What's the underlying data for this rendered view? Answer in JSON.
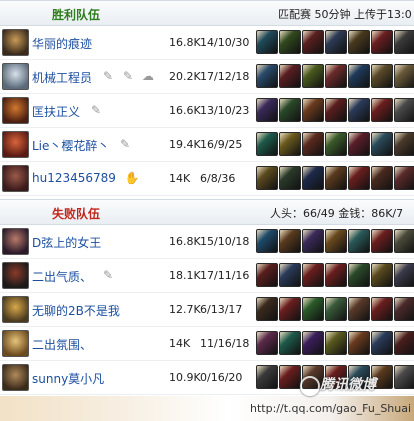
{
  "win_team": {
    "title": "胜利队伍",
    "info": "匹配赛 50分钟 上传于13:0",
    "players": [
      {
        "name": "华丽的痕迹",
        "gold": "16.8K",
        "kda": "14/10/30",
        "badges": [],
        "avatar": [
          "#3a2a1c",
          "#c89b57"
        ],
        "items": [
          "#1f4a5a",
          "#314a1e",
          "#5a1f1f",
          "#2c3a55",
          "#4a3a1e",
          "#6a1e20",
          "#3a3a3a"
        ]
      },
      {
        "name": "机械工程员",
        "gold": "20.2K",
        "kda": "17/12/18",
        "badges": [
          "✎",
          "✎",
          "☁"
        ],
        "avatar": [
          "#5a6a7a",
          "#d8e0ea"
        ],
        "items": [
          "#2a4a6a",
          "#5a1e22",
          "#4a5a1e",
          "#6a2a2a",
          "#1e3a5a",
          "#5a4a2a",
          "#6a5a3a"
        ]
      },
      {
        "name": "匡扶正义",
        "gold": "16.6K",
        "kda": "13/10/23",
        "badges": [
          "✎"
        ],
        "avatar": [
          "#4a1e10",
          "#d2782e"
        ],
        "items": [
          "#3a2a5a",
          "#2a4a2a",
          "#6a3a1e",
          "#5a1e1e",
          "#2a3a5a",
          "#6a1e1e",
          "#4a4a4a"
        ]
      },
      {
        "name": "Lie丶樱花醉丶",
        "gold": "19.4K",
        "kda": "16/9/25",
        "badges": [
          "✎"
        ],
        "avatar": [
          "#5a1a14",
          "#d8643a"
        ],
        "items": [
          "#1e5a4a",
          "#6a5a1e",
          "#5a2a1e",
          "#3a5a2a",
          "#5a1e2a",
          "#2a4a5a",
          "#4a3a2a"
        ]
      },
      {
        "name": "hu123456789",
        "gold": "14K",
        "kda": "6/8/36",
        "badges": [
          "✋"
        ],
        "avatar": [
          "#3a1a1a",
          "#9a5a4a"
        ],
        "items": [
          "#5a4a1e",
          "#2a3a2a",
          "#1e2a4a",
          "#5a3a1e",
          "#6a1e1e",
          "#4a2a1e",
          "#5a2a2a"
        ]
      }
    ]
  },
  "lose_team": {
    "title": "失败队伍",
    "info": "人头：66/49 金钱：86K/7",
    "players": [
      {
        "name": "D弦上的女王",
        "gold": "16.8K",
        "kda": "15/10/18",
        "badges": [],
        "avatar": [
          "#2a1a2a",
          "#b87a6a"
        ],
        "items": [
          "#1e4a6a",
          "#5a3a1e",
          "#3a2a5a",
          "#6a4a1e",
          "#2a5a5a",
          "#6a1e1e",
          "#4a4a3a"
        ]
      },
      {
        "name": "二出气质、",
        "gold": "18.1K",
        "kda": "17/11/16",
        "badges": [
          "✎"
        ],
        "avatar": [
          "#1a1a1a",
          "#8a3a2a"
        ],
        "items": [
          "#5a1e1e",
          "#2a3a5a",
          "#6a1e1e",
          "#6a1e1e",
          "#2a4a2a",
          "#5a4a1e",
          "#3a3a4a"
        ]
      },
      {
        "name": "无聊的2B不是我",
        "gold": "12.7K",
        "kda": "6/13/17",
        "badges": [],
        "avatar": [
          "#4a3a1e",
          "#d8a84a"
        ],
        "items": [
          "#3a2a1e",
          "#6a1e1e",
          "#2a5a2a",
          "#3a5a3a",
          "#5a3a2a",
          "#6a1e1e",
          "#4a2a2a"
        ]
      },
      {
        "name": "二出氛围、",
        "gold": "14K",
        "kda": "11/16/18",
        "badges": [],
        "avatar": [
          "#6a4a1e",
          "#e8c47a"
        ],
        "items": [
          "#5a2a4a",
          "#1e5a4a",
          "#3a1e5a",
          "#5a5a1e",
          "#6a3a1e",
          "#2a3a5a",
          "#4a1e1e"
        ]
      },
      {
        "name": "sunny莫小凡",
        "gold": "10.9K",
        "kda": "0/16/20",
        "badges": [],
        "avatar": [
          "#3a2a1a",
          "#b08a5a"
        ],
        "items": [
          "#3a3a3a",
          "#6a1e1e",
          "#5a3a2a",
          "#6a1e1e",
          "#2a4a5a",
          "#5a3a1e",
          "#4a4a4a"
        ]
      }
    ]
  },
  "footer": {
    "url": "http://t.qq.com/gao_Fu_Shuai",
    "watermark": "腾讯微博"
  }
}
